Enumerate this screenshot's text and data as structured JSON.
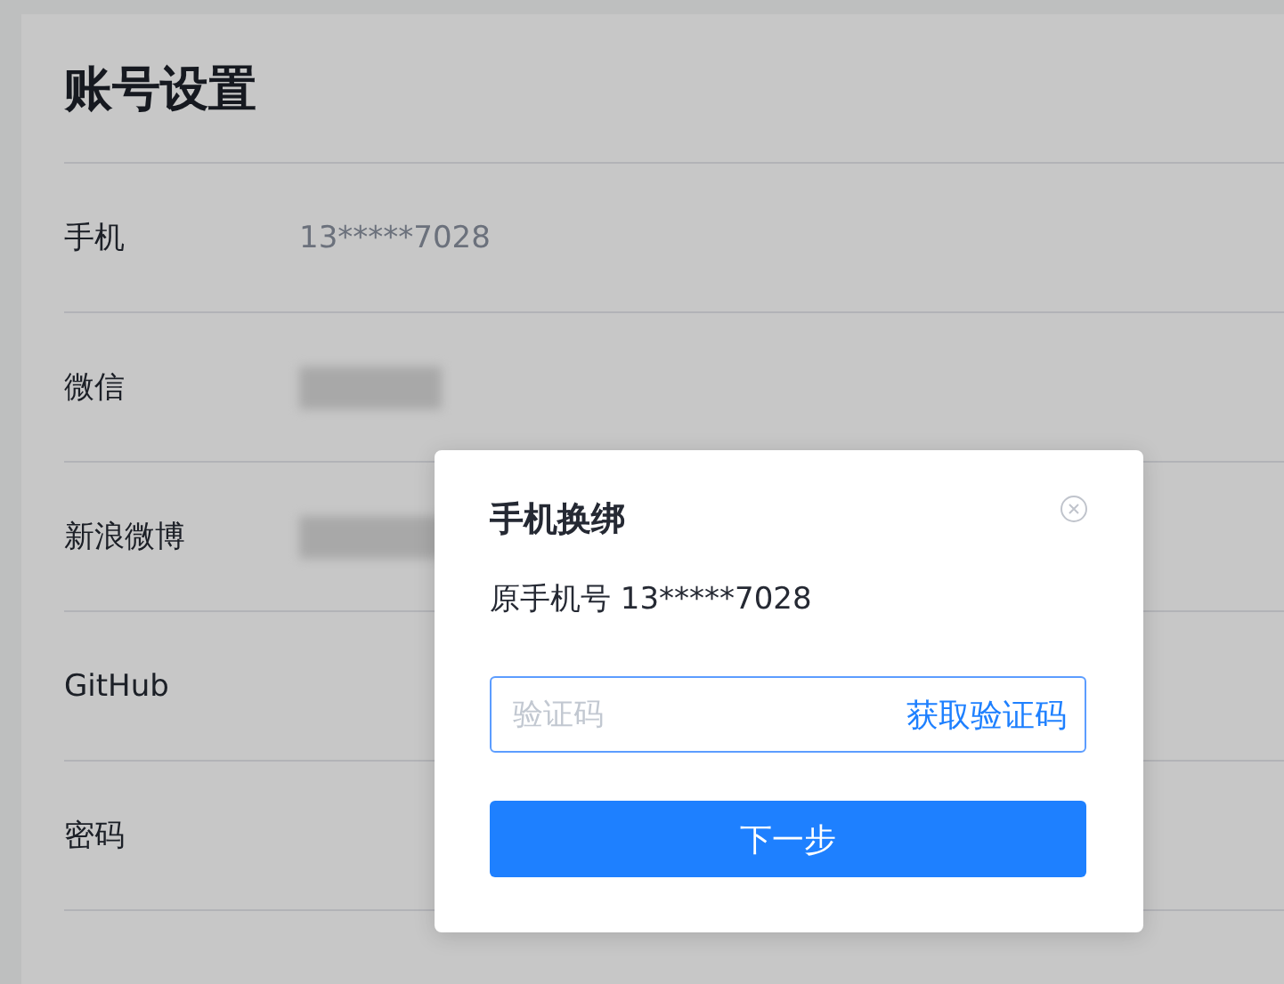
{
  "page": {
    "title": "账号设置"
  },
  "settings": [
    {
      "label": "手机",
      "value": "13*****7028",
      "kind": "text"
    },
    {
      "label": "微信",
      "kind": "redacted"
    },
    {
      "label": "新浪微博",
      "kind": "redacted"
    },
    {
      "label": "GitHub",
      "kind": "none"
    },
    {
      "label": "密码",
      "kind": "none"
    }
  ],
  "dialog": {
    "title": "手机换绑",
    "message": "原手机号 13*****7028",
    "code_field": {
      "placeholder": "验证码"
    },
    "get_code_link": "获取验证码",
    "next_button": "下一步"
  }
}
